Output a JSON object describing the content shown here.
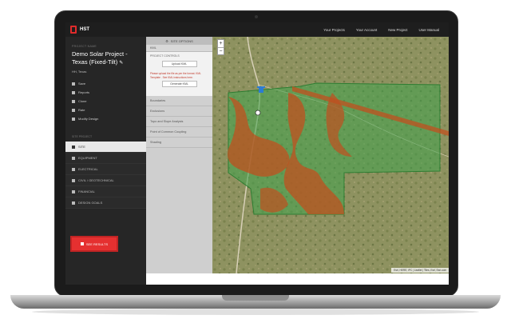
{
  "nav": {
    "brand": "HST",
    "links": [
      "Your Projects",
      "Your Account",
      "New Project",
      "User Manual"
    ]
  },
  "sidebar": {
    "project_tag": "PROJECT NAME",
    "project_title": "Demo Solar Project - Texas (Fixed-Tilt)",
    "project_location": "HH, Texas",
    "links": [
      "Save",
      "Reports",
      "Clone",
      "Rate",
      "Modify Design"
    ],
    "steps_header": "SITE PROJECT",
    "steps": [
      "SITE",
      "EQUIPMENT",
      "ELECTRICAL",
      "CIVIL / GEOTECHNICAL",
      "FINANCIAL",
      "DESIGN GOALS"
    ],
    "results_button": "SEE RESULTS"
  },
  "options": {
    "header": "SITE OPTIONS",
    "kml_section": "KML",
    "controls_label": "PROJECT CONTROLS",
    "upload_button": "Upload KML",
    "note": "Please upload the file as per the format. KML Template . See KML instructions here.",
    "generate_button": "Generate KML",
    "items": [
      "Boundaries",
      "Exclusions",
      "Topo and Slope Analysis",
      "Point of Common Coupling",
      "Shading"
    ]
  },
  "map": {
    "zoom_in": "+",
    "zoom_out": "−",
    "attribution": "Esri, HERE, iPC | Leaflet | Tiles, Esri, Esri.com"
  },
  "colors": {
    "accent": "#e53030",
    "boundary_fill": "#4caf50",
    "exclusion_fill": "#c0501f"
  }
}
